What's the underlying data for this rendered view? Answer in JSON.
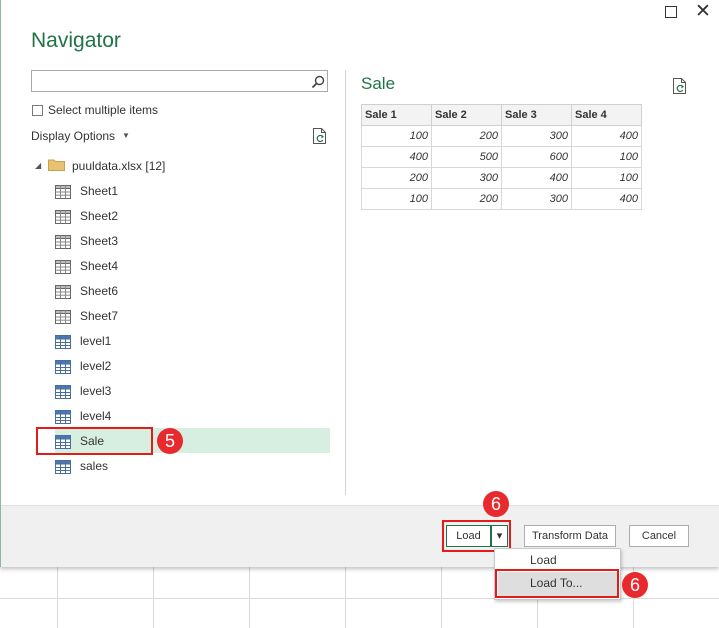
{
  "window": {
    "title": "Navigator",
    "maximize_icon": "maximize-icon",
    "close_icon": "close-icon",
    "close_glyph": "✕"
  },
  "search": {
    "value": "",
    "placeholder": ""
  },
  "select_multiple": {
    "label": "Select multiple items",
    "checked": false
  },
  "display_options": {
    "label": "Display Options",
    "caret": "▼"
  },
  "tree": {
    "root": {
      "label": "puuldata.xlsx [12]",
      "caret": "◢",
      "icon": "folder-icon"
    },
    "items": [
      {
        "label": "Sheet1",
        "kind": "sheet"
      },
      {
        "label": "Sheet2",
        "kind": "sheet"
      },
      {
        "label": "Sheet3",
        "kind": "sheet"
      },
      {
        "label": "Sheet4",
        "kind": "sheet"
      },
      {
        "label": "Sheet6",
        "kind": "sheet"
      },
      {
        "label": "Sheet7",
        "kind": "sheet"
      },
      {
        "label": "level1",
        "kind": "table"
      },
      {
        "label": "level2",
        "kind": "table"
      },
      {
        "label": "level3",
        "kind": "table"
      },
      {
        "label": "level4",
        "kind": "table"
      },
      {
        "label": "Sale",
        "kind": "table",
        "selected": true
      },
      {
        "label": "sales",
        "kind": "table"
      }
    ]
  },
  "preview": {
    "title": "Sale",
    "columns": [
      "Sale 1",
      "Sale 2",
      "Sale 3",
      "Sale 4"
    ],
    "rows": [
      [
        "100",
        "200",
        "300",
        "400"
      ],
      [
        "400",
        "500",
        "600",
        "100"
      ],
      [
        "200",
        "300",
        "400",
        "100"
      ],
      [
        "100",
        "200",
        "300",
        "400"
      ]
    ]
  },
  "footer": {
    "load_label": "Load",
    "load_arrow": "▾",
    "transform_label": "Transform Data",
    "cancel_label": "Cancel"
  },
  "dropdown": {
    "items": [
      {
        "label": "Load"
      },
      {
        "label": "Load To...",
        "highlighted": true
      }
    ]
  },
  "markers": [
    {
      "label": "5"
    },
    {
      "label": "6"
    },
    {
      "label": "6"
    }
  ],
  "colors": {
    "accent": "#217346",
    "selection": "#d7efe1",
    "marker": "#e21b1b",
    "footer_bg": "#f0f0f0"
  }
}
